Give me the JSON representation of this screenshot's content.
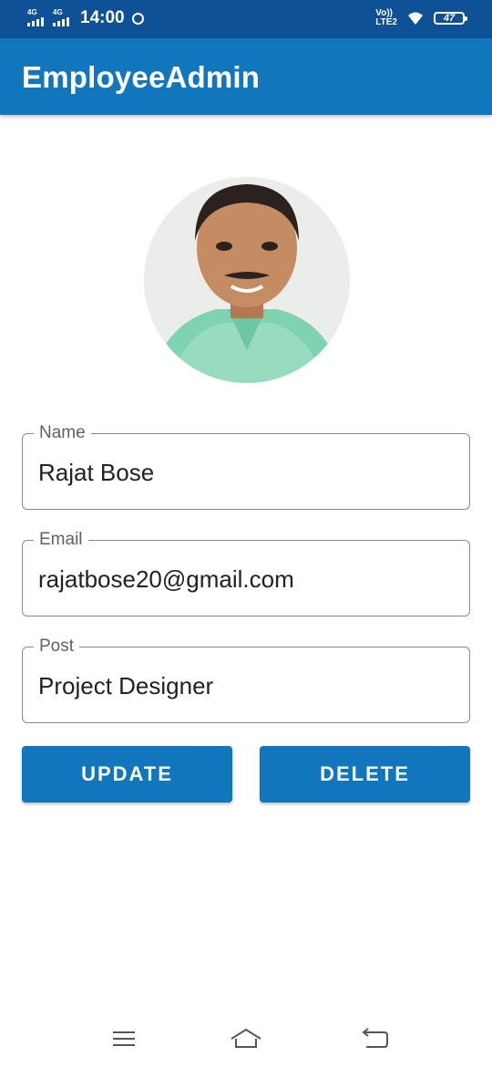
{
  "status_bar": {
    "network_1": "4G",
    "network_2": "4G",
    "time": "14:00",
    "lte_top": "Vo))",
    "lte_bottom": "LTE2",
    "battery": "47"
  },
  "app_bar": {
    "title": "EmployeeAdmin"
  },
  "form": {
    "name": {
      "label": "Name",
      "value": "Rajat Bose"
    },
    "email": {
      "label": "Email",
      "value": "rajatbose20@gmail.com"
    },
    "post": {
      "label": "Post",
      "value": "Project Designer"
    }
  },
  "actions": {
    "update_label": "UPDATE",
    "delete_label": "DELETE"
  },
  "colors": {
    "status_bar": "#0f5196",
    "app_bar": "#1276bc",
    "button": "#1276bc",
    "field_border": "#8a8a8a"
  },
  "icons": {
    "status": [
      "signal-icon",
      "signal-icon",
      "whatsapp-icon",
      "wifi-icon",
      "battery-icon"
    ],
    "nav": [
      "menu-icon",
      "home-icon",
      "back-icon"
    ]
  }
}
